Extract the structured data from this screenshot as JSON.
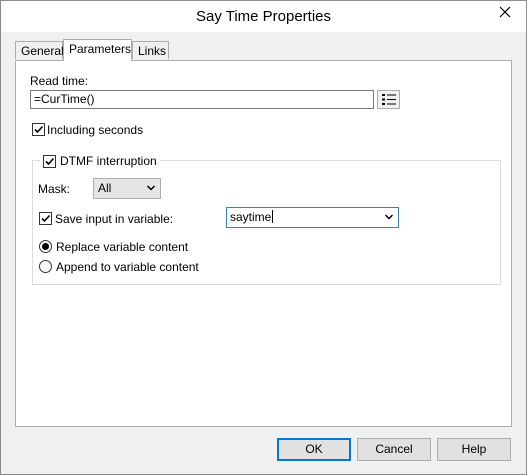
{
  "window": {
    "title": "Say Time Properties"
  },
  "tabs": [
    {
      "label": "General",
      "active": false
    },
    {
      "label": "Parameters",
      "active": true
    },
    {
      "label": "Links",
      "active": false
    }
  ],
  "parameters": {
    "read_time_label": "Read time:",
    "read_time_value": "=CurTime()",
    "including_seconds_label": "Including seconds",
    "including_seconds_checked": true,
    "dtmf": {
      "label": "DTMF interruption",
      "checked": true,
      "mask_label": "Mask:",
      "mask_value": "All",
      "save_input_label": "Save input in variable:",
      "save_input_checked": true,
      "variable_value": "saytime",
      "replace_label": "Replace variable content",
      "replace_selected": true,
      "append_label": "Append to variable content",
      "append_selected": false
    }
  },
  "buttons": {
    "ok": "OK",
    "cancel": "Cancel",
    "help": "Help"
  },
  "icons": {
    "close": "close-icon",
    "expression_builder": "list-icon",
    "dropdown": "chevron-down-icon",
    "check": "check-icon"
  },
  "colors": {
    "close_hover": "#e81123",
    "focus_border": "#3c7fb1",
    "default_button_border": "#0078d7"
  }
}
